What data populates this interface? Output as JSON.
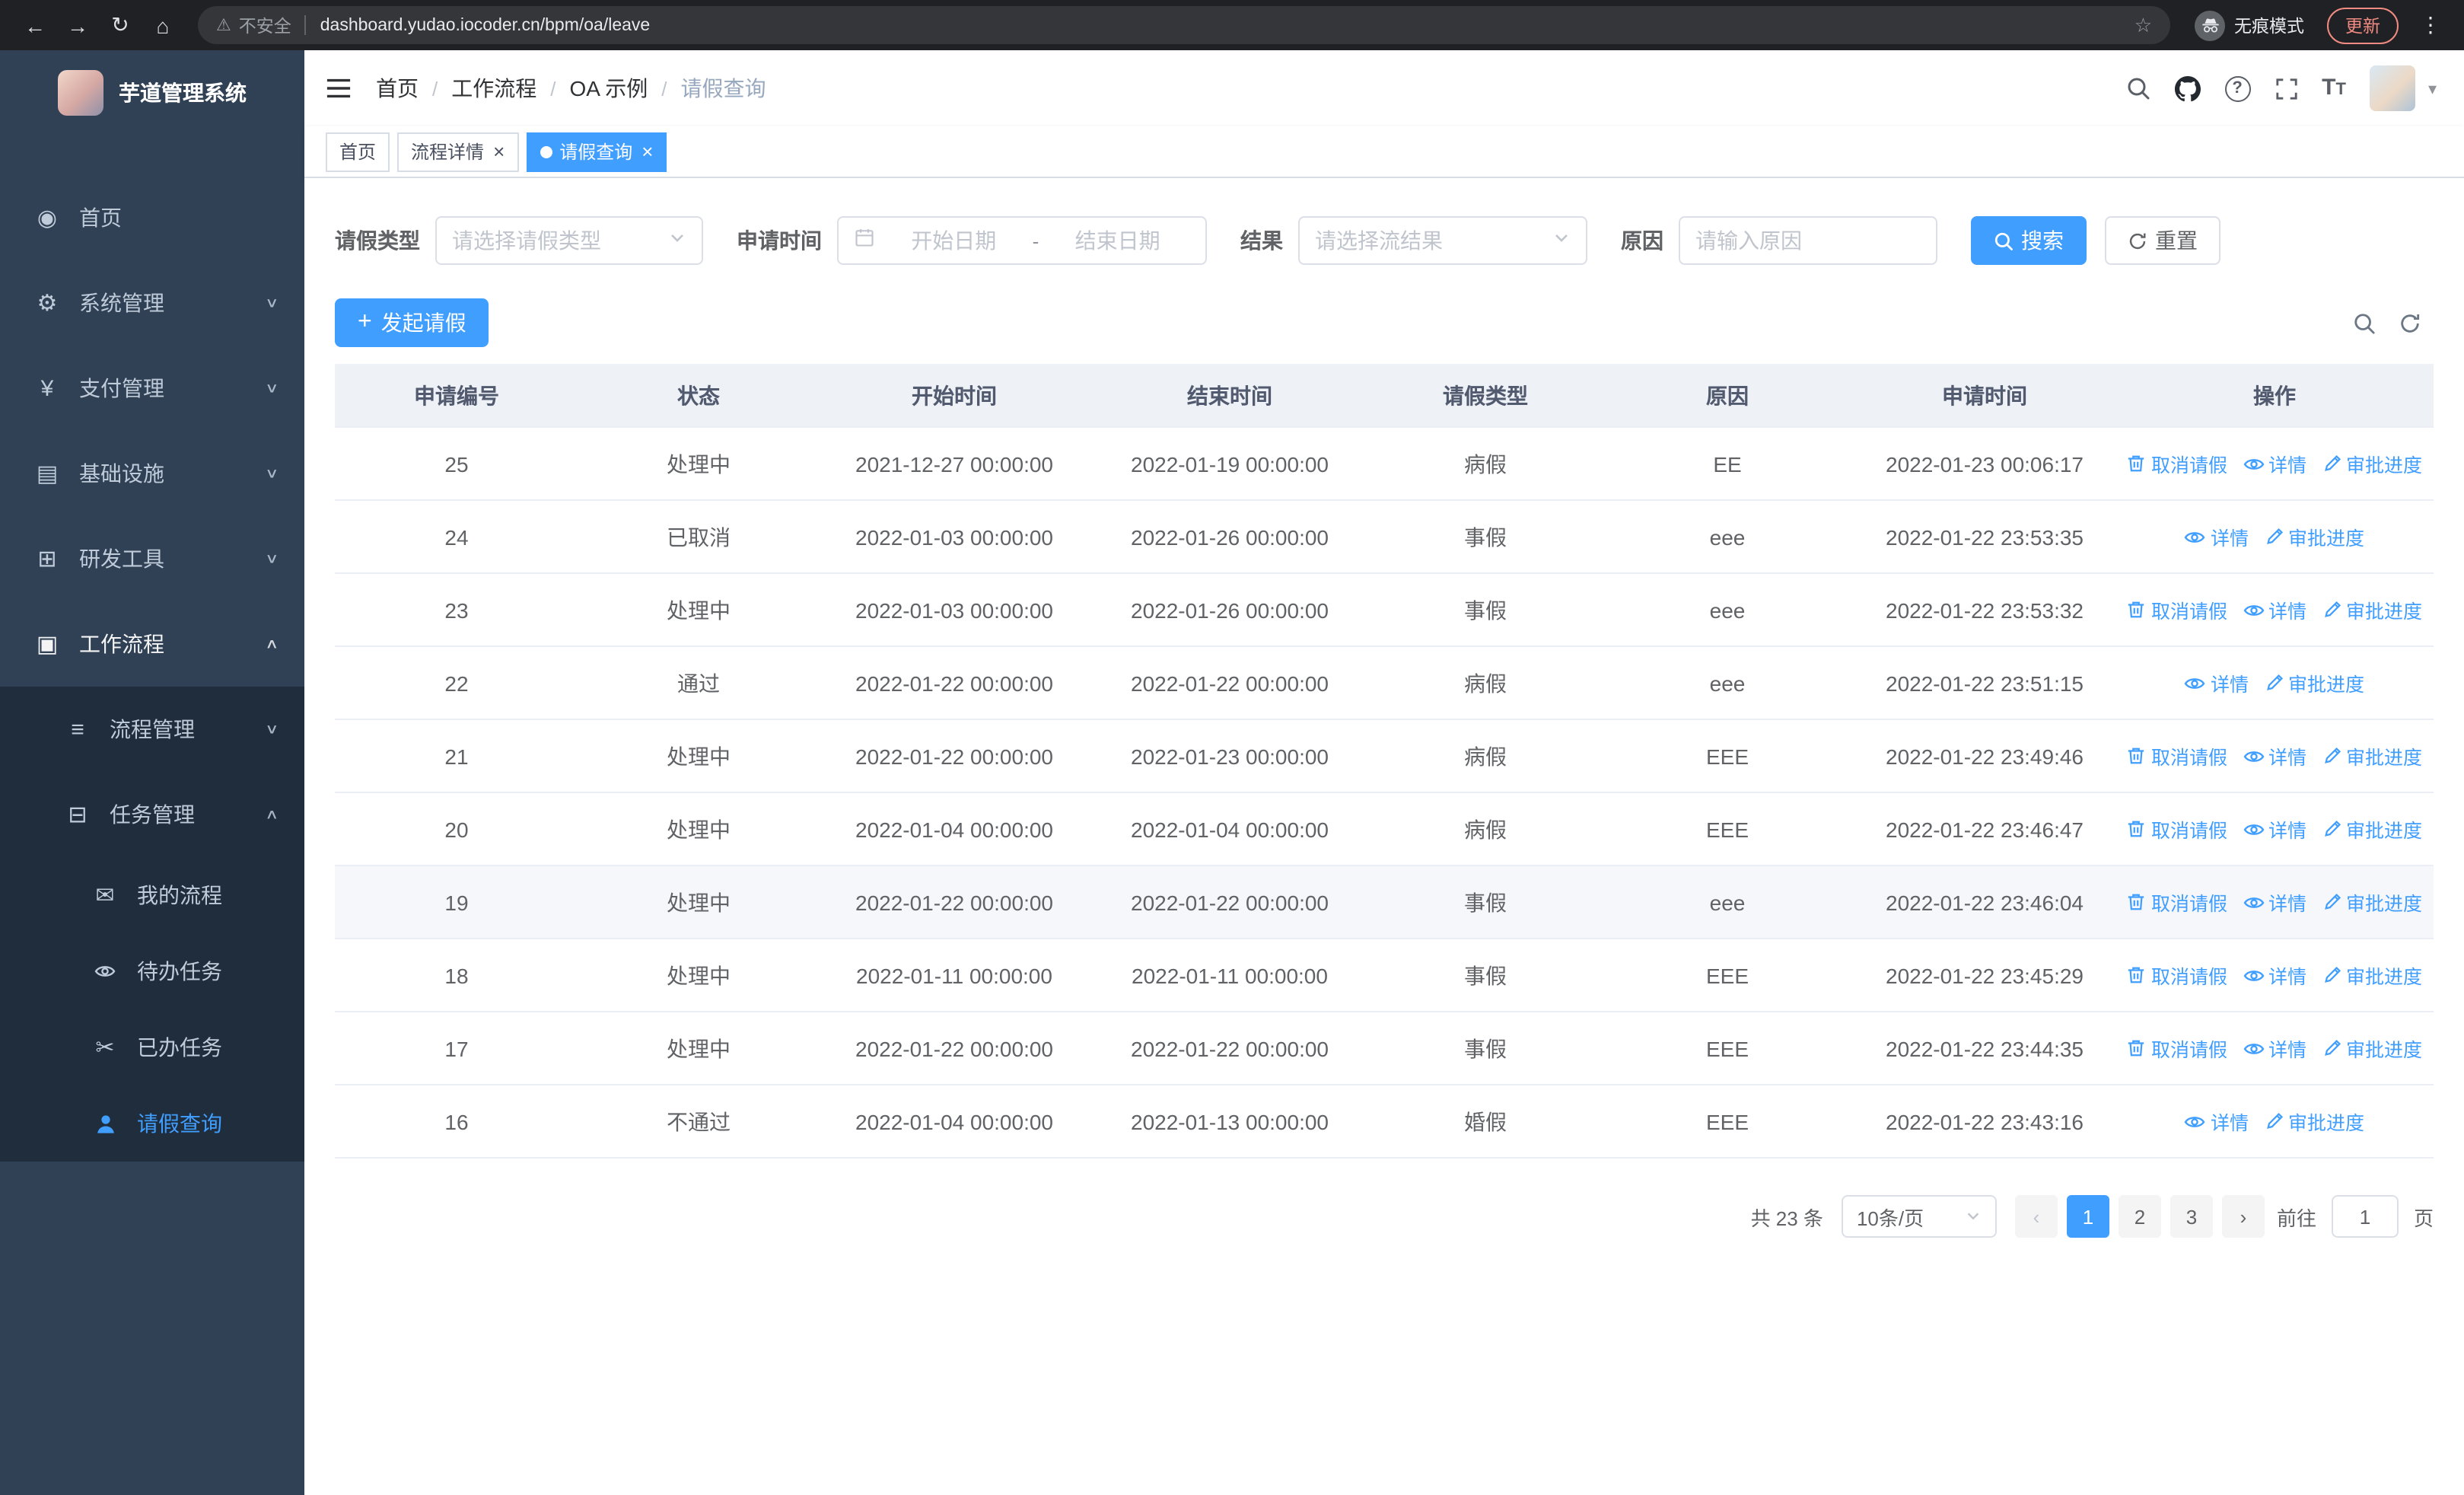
{
  "colors": {
    "accent": "#409eff",
    "sidebar_bg": "#304156",
    "sidebar_submenu_bg": "#1f2d3d",
    "sidebar_text": "#bfcbd9",
    "link": "#409eff"
  },
  "browser": {
    "security_label": "不安全",
    "url": "dashboard.yudao.iocoder.cn/bpm/oa/leave",
    "incognito_label": "无痕模式",
    "update_label": "更新"
  },
  "sidebar": {
    "logo_title": "芋道管理系统",
    "items": [
      {
        "name": "home",
        "label": "首页",
        "icon": "dashboard-icon",
        "level": 1
      },
      {
        "name": "system-management",
        "label": "系统管理",
        "icon": "gear-icon",
        "level": 1,
        "chevron": "down"
      },
      {
        "name": "payment-management",
        "label": "支付管理",
        "icon": "yen-icon",
        "level": 1,
        "chevron": "down"
      },
      {
        "name": "infrastructure",
        "label": "基础设施",
        "icon": "infra-icon",
        "level": 1,
        "chevron": "down"
      },
      {
        "name": "dev-tools",
        "label": "研发工具",
        "icon": "toolbox-icon",
        "level": 1,
        "chevron": "down"
      },
      {
        "name": "workflow",
        "label": "工作流程",
        "icon": "workflow-icon",
        "level": 1,
        "chevron": "up",
        "expanded": true
      },
      {
        "name": "process-management",
        "label": "流程管理",
        "icon": "process-icon",
        "level": 2,
        "chevron": "down"
      },
      {
        "name": "task-management",
        "label": "任务管理",
        "icon": "task-icon",
        "level": 2,
        "chevron": "up"
      },
      {
        "name": "my-process",
        "label": "我的流程",
        "icon": "message-icon",
        "level": 3
      },
      {
        "name": "todo-tasks",
        "label": "待办任务",
        "icon": "eye-icon",
        "level": 3
      },
      {
        "name": "done-tasks",
        "label": "已办任务",
        "icon": "scissors-icon",
        "level": 3
      },
      {
        "name": "leave-query",
        "label": "请假查询",
        "icon": "user-icon",
        "level": 3,
        "active": true
      }
    ]
  },
  "header": {
    "breadcrumb": {
      "separator": "/",
      "items": [
        {
          "name": "home",
          "label": "首页"
        },
        {
          "name": "workflow",
          "label": "工作流程"
        },
        {
          "name": "oa-example",
          "label": "OA 示例"
        },
        {
          "name": "leave-query",
          "label": "请假查询"
        }
      ]
    }
  },
  "tabs": [
    {
      "name": "home",
      "label": "首页",
      "closable": false,
      "active": false
    },
    {
      "name": "process-detail",
      "label": "流程详情",
      "closable": true,
      "active": false
    },
    {
      "name": "leave-query",
      "label": "请假查询",
      "closable": true,
      "active": true
    }
  ],
  "filters": {
    "leave_type": {
      "label": "请假类型",
      "placeholder": "请选择请假类型"
    },
    "apply_time": {
      "label": "申请时间",
      "start_placeholder": "开始日期",
      "separator": "-",
      "end_placeholder": "结束日期"
    },
    "result": {
      "label": "结果",
      "placeholder": "请选择流结果"
    },
    "reason": {
      "label": "原因",
      "placeholder": "请输入原因"
    },
    "search_label": "搜索",
    "reset_label": "重置"
  },
  "toolbar": {
    "create_label": "发起请假"
  },
  "table": {
    "columns": [
      {
        "name": "apply-id",
        "label": "申请编号"
      },
      {
        "name": "status",
        "label": "状态"
      },
      {
        "name": "start-time",
        "label": "开始时间"
      },
      {
        "name": "end-time",
        "label": "结束时间"
      },
      {
        "name": "leave-type",
        "label": "请假类型"
      },
      {
        "name": "reason",
        "label": "原因"
      },
      {
        "name": "apply-time",
        "label": "申请时间"
      },
      {
        "name": "actions",
        "label": "操作"
      }
    ],
    "action_labels": {
      "cancel": "取消请假",
      "detail": "详情",
      "progress": "审批进度"
    },
    "rows": [
      {
        "id": "25",
        "status": "处理中",
        "start": "2021-12-27 00:00:00",
        "end": "2022-01-19 00:00:00",
        "type": "病假",
        "reason": "EE",
        "applied": "2022-01-23 00:06:17",
        "actions": [
          "cancel",
          "detail",
          "progress"
        ]
      },
      {
        "id": "24",
        "status": "已取消",
        "start": "2022-01-03 00:00:00",
        "end": "2022-01-26 00:00:00",
        "type": "事假",
        "reason": "eee",
        "applied": "2022-01-22 23:53:35",
        "actions": [
          "detail",
          "progress"
        ]
      },
      {
        "id": "23",
        "status": "处理中",
        "start": "2022-01-03 00:00:00",
        "end": "2022-01-26 00:00:00",
        "type": "事假",
        "reason": "eee",
        "applied": "2022-01-22 23:53:32",
        "actions": [
          "cancel",
          "detail",
          "progress"
        ]
      },
      {
        "id": "22",
        "status": "通过",
        "start": "2022-01-22 00:00:00",
        "end": "2022-01-22 00:00:00",
        "type": "病假",
        "reason": "eee",
        "applied": "2022-01-22 23:51:15",
        "actions": [
          "detail",
          "progress"
        ]
      },
      {
        "id": "21",
        "status": "处理中",
        "start": "2022-01-22 00:00:00",
        "end": "2022-01-23 00:00:00",
        "type": "病假",
        "reason": "EEE",
        "applied": "2022-01-22 23:49:46",
        "actions": [
          "cancel",
          "detail",
          "progress"
        ]
      },
      {
        "id": "20",
        "status": "处理中",
        "start": "2022-01-04 00:00:00",
        "end": "2022-01-04 00:00:00",
        "type": "病假",
        "reason": "EEE",
        "applied": "2022-01-22 23:46:47",
        "actions": [
          "cancel",
          "detail",
          "progress"
        ]
      },
      {
        "id": "19",
        "status": "处理中",
        "start": "2022-01-22 00:00:00",
        "end": "2022-01-22 00:00:00",
        "type": "事假",
        "reason": "eee",
        "applied": "2022-01-22 23:46:04",
        "actions": [
          "cancel",
          "detail",
          "progress"
        ],
        "highlighted": true
      },
      {
        "id": "18",
        "status": "处理中",
        "start": "2022-01-11 00:00:00",
        "end": "2022-01-11 00:00:00",
        "type": "事假",
        "reason": "EEE",
        "applied": "2022-01-22 23:45:29",
        "actions": [
          "cancel",
          "detail",
          "progress"
        ]
      },
      {
        "id": "17",
        "status": "处理中",
        "start": "2022-01-22 00:00:00",
        "end": "2022-01-22 00:00:00",
        "type": "事假",
        "reason": "EEE",
        "applied": "2022-01-22 23:44:35",
        "actions": [
          "cancel",
          "detail",
          "progress"
        ]
      },
      {
        "id": "16",
        "status": "不通过",
        "start": "2022-01-04 00:00:00",
        "end": "2022-01-13 00:00:00",
        "type": "婚假",
        "reason": "EEE",
        "applied": "2022-01-22 23:43:16",
        "actions": [
          "detail",
          "progress"
        ]
      }
    ]
  },
  "pagination": {
    "total_label": "共 23 条",
    "page_size": "10条/页",
    "pages": [
      {
        "label": "1",
        "active": true
      },
      {
        "label": "2",
        "active": false
      },
      {
        "label": "3",
        "active": false
      }
    ],
    "goto_label": "前往",
    "goto_value": "1",
    "page_label": "页"
  }
}
